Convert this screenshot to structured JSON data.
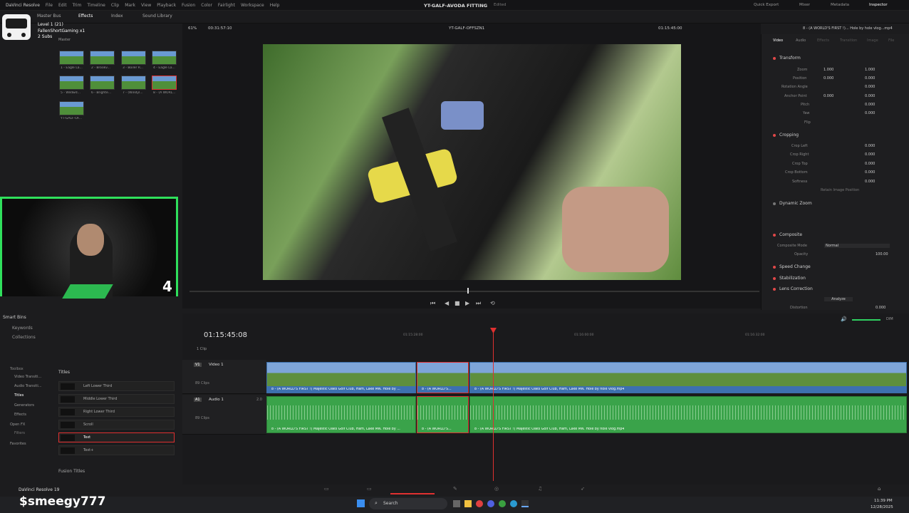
{
  "menu": [
    "DaVinci Resolve",
    "File",
    "Edit",
    "Trim",
    "Timeline",
    "Clip",
    "Mark",
    "View",
    "Playback",
    "Fusion",
    "Color",
    "Fairlight",
    "Workspace",
    "Help"
  ],
  "project_title": "YT-GALF-AVODA FITTING",
  "project_status": "Edited",
  "toolbar_right": [
    "Quick Export",
    "Mixer",
    "Metadata",
    "Inspector"
  ],
  "toolbar_left": [
    "Master Bus",
    "Effects",
    "Index",
    "Sound Library"
  ],
  "overlay": {
    "level": "Level 1 (21)",
    "name": "FallenShortGaming x1",
    "subs": "2 Subs",
    "bin": "Master",
    "counter": "4",
    "streamer": "$smeegy777"
  },
  "viewer": {
    "zoom": "61%",
    "source_tc": "00:31:57:10",
    "timeline_name": "YT-GALF-OFFSZN1",
    "timecode": "01:15:45:00"
  },
  "clip_file_title": "8 - (A WORLD'S FIRST !)... Hole by hole vlog...mp4",
  "media_thumbs": [
    "1 - Eagle La...",
    "2 - Brookv...",
    "3 - Boiler R...",
    "4 - Eagle La...",
    "5 - Wildwd...",
    "6 - Brighte...",
    "7 - (Windyl...",
    "8 - (A WORL...",
    "YT-GALF-OF..."
  ],
  "inspector_tabs": [
    "Video",
    "Audio",
    "Effects",
    "Transition",
    "Image",
    "File"
  ],
  "inspector": {
    "transform": "Transform",
    "zoom_label": "Zoom",
    "zoom_x": "1.000",
    "zoom_y": "1.000",
    "position_label": "Position",
    "pos_x": "0.000",
    "pos_y": "0.000",
    "rotation_label": "Rotation Angle",
    "rotation": "0.000",
    "anchor_label": "Anchor Point",
    "anchor_x": "0.000",
    "anchor_y": "0.000",
    "pitch_label": "Pitch",
    "pitch": "0.000",
    "yaw_label": "Yaw",
    "yaw": "0.000",
    "flip_label": "Flip",
    "cropping": "Cropping",
    "crop_left_label": "Crop Left",
    "crop_left": "0.000",
    "crop_right_label": "Crop Right",
    "crop_right": "0.000",
    "crop_top_label": "Crop Top",
    "crop_top": "0.000",
    "crop_bottom_label": "Crop Bottom",
    "crop_bottom": "0.000",
    "softness_label": "Softness",
    "softness": "0.000",
    "retain_label": "Retain Image Position",
    "dynamic_zoom": "Dynamic Zoom",
    "composite": "Composite",
    "composite_mode_label": "Composite Mode",
    "composite_mode": "Normal",
    "opacity_label": "Opacity",
    "opacity": "100.00",
    "speed_change": "Speed Change",
    "stabilization": "Stabilization",
    "lens_correction": "Lens Correction",
    "analyze": "Analyze",
    "distortion_label": "Distortion",
    "distortion": "0.000"
  },
  "timeline": {
    "timecode": "01:15:45:08",
    "clip_count": "1 Clip",
    "v1": "V1",
    "video_track": "Video 1",
    "v_clips": "89 Clips",
    "a1": "A1",
    "audio_track": "Audio 1",
    "a_level": "2.0",
    "a_clips": "89 Clips",
    "ruler": [
      "01:15:28:00",
      "01:16:00:00",
      "01:16:32:00"
    ],
    "clip_main": "8 - (A WORLD'S FIRST !) Majestic Oaks Golf Club, Ham, Lake MN.  Hole by hole vlog.mp4",
    "clip_main_short": "8 - (A WORLD'S FIRST !) Majestic Oaks Golf Club, Ham, Lake MN.  Hole by ...",
    "clip_mid": "8 - (A WORLD'S...",
    "meter": "DIM"
  },
  "left_panel": {
    "smart_bins": "Smart Bins",
    "keywords": "Keywords",
    "collections": "Collections",
    "toolbox": "Toolbox",
    "video_transitions": "Video Transiti...",
    "audio_transitions": "Audio Transiti...",
    "titles": "Titles",
    "generators": "Generators",
    "effects": "Effects",
    "openfx": "Open FX",
    "filters": "Filters",
    "favorites": "Favorites",
    "titles_header": "Titles",
    "fusion_titles": "Fusion Titles",
    "title_items": [
      "Left Lower Third",
      "Middle Lower Third",
      "Right Lower Third",
      "Scroll",
      "Text",
      "Text+"
    ]
  },
  "app_label": "DaVinci Resolve 19",
  "taskbar": {
    "search": "Search",
    "time": "11:39 PM",
    "date": "12/28/2025"
  }
}
